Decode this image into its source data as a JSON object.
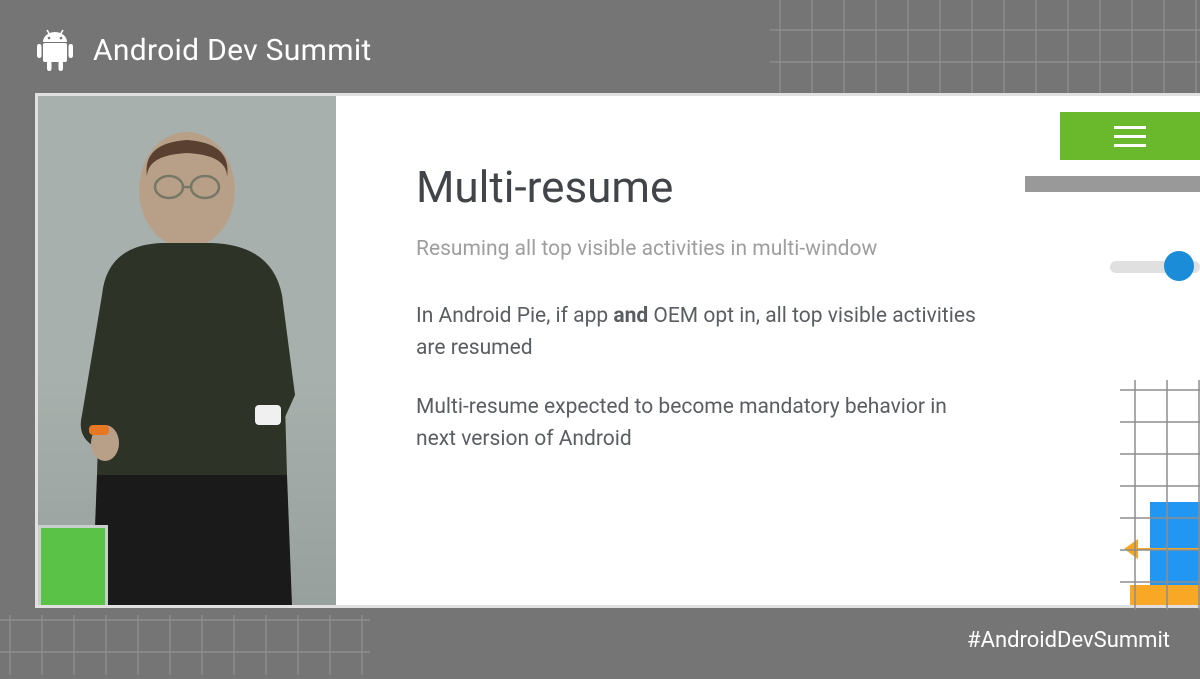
{
  "header": {
    "title": "Android Dev Summit"
  },
  "slide": {
    "title": "Multi-resume",
    "subtitle": "Resuming all top visible activities in multi-window",
    "body1_pre": "In Android Pie, if app ",
    "body1_bold": "and",
    "body1_post": " OEM opt in, all top visible activities are resumed",
    "body2": "Multi-resume expected to become mandatory behavior in next version of Android"
  },
  "footer": {
    "hashtag": "#AndroidDevSummit"
  },
  "colors": {
    "accent_green": "#6ab82c",
    "accent_blue": "#2196f3",
    "accent_yellow": "#f9a825",
    "accent_orange": "#f5a623"
  }
}
